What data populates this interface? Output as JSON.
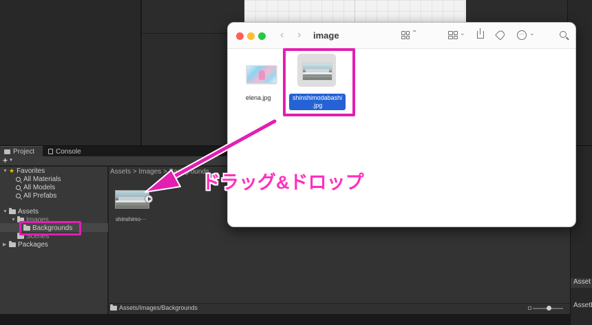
{
  "editor": {
    "tabs": [
      {
        "label": "Project"
      },
      {
        "label": "Console"
      }
    ],
    "plus_label": "+",
    "tree": {
      "favorites_label": "Favorites",
      "favorites_items": [
        "All Materials",
        "All Models",
        "All Prefabs"
      ],
      "assets_label": "Assets",
      "images_label": "Images",
      "backgrounds_label": "Backgrounds",
      "scenes_label": "Scenes",
      "packages_label": "Packages"
    },
    "breadcrumb": "Assets > Images > Backgrounds",
    "asset_item_label": "shinshimo···",
    "status_path": "Assets/Images/Backgrounds",
    "right_panel_top_label": "Asset",
    "right_panel_bottom_label": "AssetB"
  },
  "finder": {
    "title": "image",
    "files": [
      {
        "name": "elena.jpg"
      },
      {
        "name_line1": "shinshimodabashi",
        "name_line2": ".jpg"
      }
    ]
  },
  "annotation": {
    "caption": "ドラッグ&ドロップ",
    "accent_color": "#e21fb2"
  },
  "icons": [
    "folder-icon",
    "star-icon",
    "search-icon",
    "grid-view-icon",
    "share-icon",
    "tag-icon",
    "more-icon",
    "play-icon",
    "console-icon"
  ]
}
